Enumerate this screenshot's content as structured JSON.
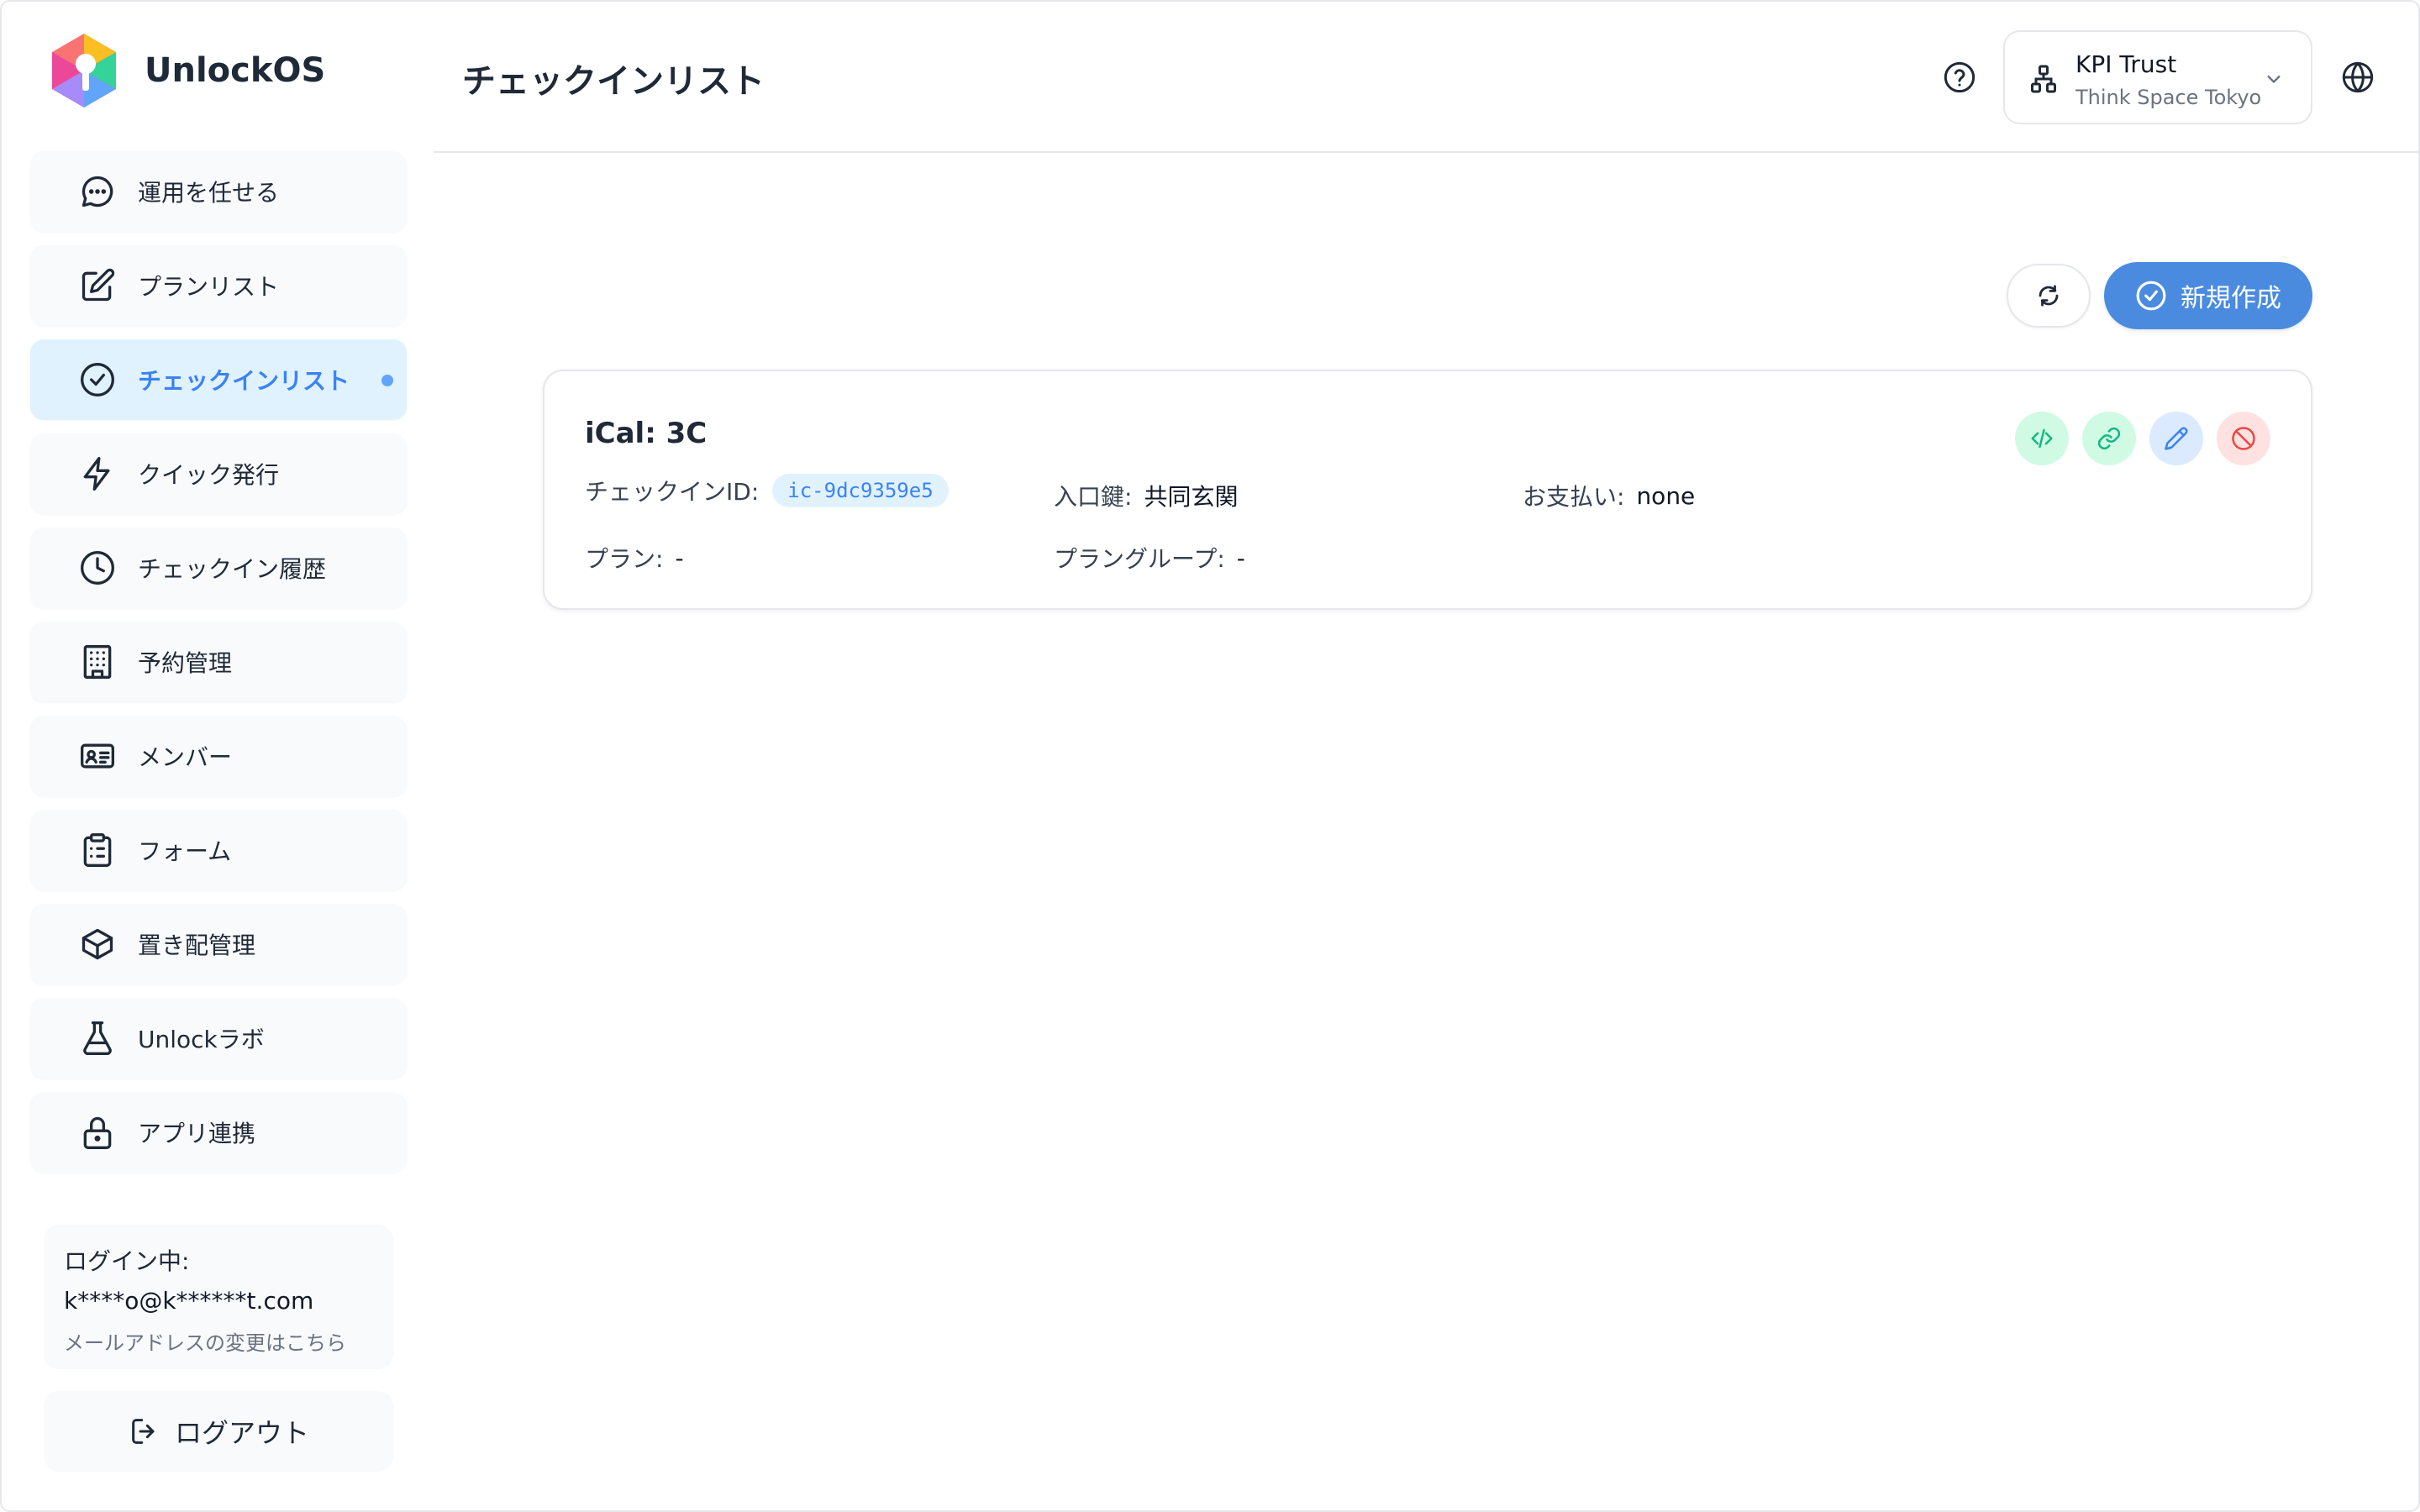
{
  "app": {
    "name": "UnlockOS"
  },
  "sidebar": {
    "items": [
      {
        "label": "運用を任せる",
        "icon": "chat-bubble-icon"
      },
      {
        "label": "プランリスト",
        "icon": "edit-square-icon"
      },
      {
        "label": "チェックインリスト",
        "icon": "check-circle-icon",
        "active": true
      },
      {
        "label": "クイック発行",
        "icon": "lightning-icon"
      },
      {
        "label": "チェックイン履歴",
        "icon": "clock-icon"
      },
      {
        "label": "予約管理",
        "icon": "building-icon"
      },
      {
        "label": "メンバー",
        "icon": "id-card-icon"
      },
      {
        "label": "フォーム",
        "icon": "clipboard-list-icon"
      },
      {
        "label": "置き配管理",
        "icon": "package-cube-icon"
      },
      {
        "label": "Unlockラボ",
        "icon": "flask-icon"
      },
      {
        "label": "アプリ連携",
        "icon": "lock-icon"
      }
    ],
    "login": {
      "label": "ログイン中:",
      "email": "k****o@k******t.com",
      "change_link": "メールアドレスの変更はこちら"
    },
    "logout_label": "ログアウト"
  },
  "header": {
    "title": "チェックインリスト",
    "org": {
      "name": "KPI Trust",
      "space": "Think Space Tokyo"
    }
  },
  "toolbar": {
    "create_label": "新規作成"
  },
  "card": {
    "title": "iCal: 3C",
    "checkin_id_label": "チェックインID:",
    "checkin_id_value": "ic-9dc9359e5",
    "entrance_label": "入口鍵:",
    "entrance_value": "共同玄関",
    "payment_label": "お支払い:",
    "payment_value": "none",
    "plan_label": "プラン:",
    "plan_value": "-",
    "plan_group_label": "プラングループ:",
    "plan_group_value": "-"
  },
  "colors": {
    "accent": "#4a8be0",
    "active_bg": "#e0f2fe",
    "active_text": "#3b82f6"
  }
}
